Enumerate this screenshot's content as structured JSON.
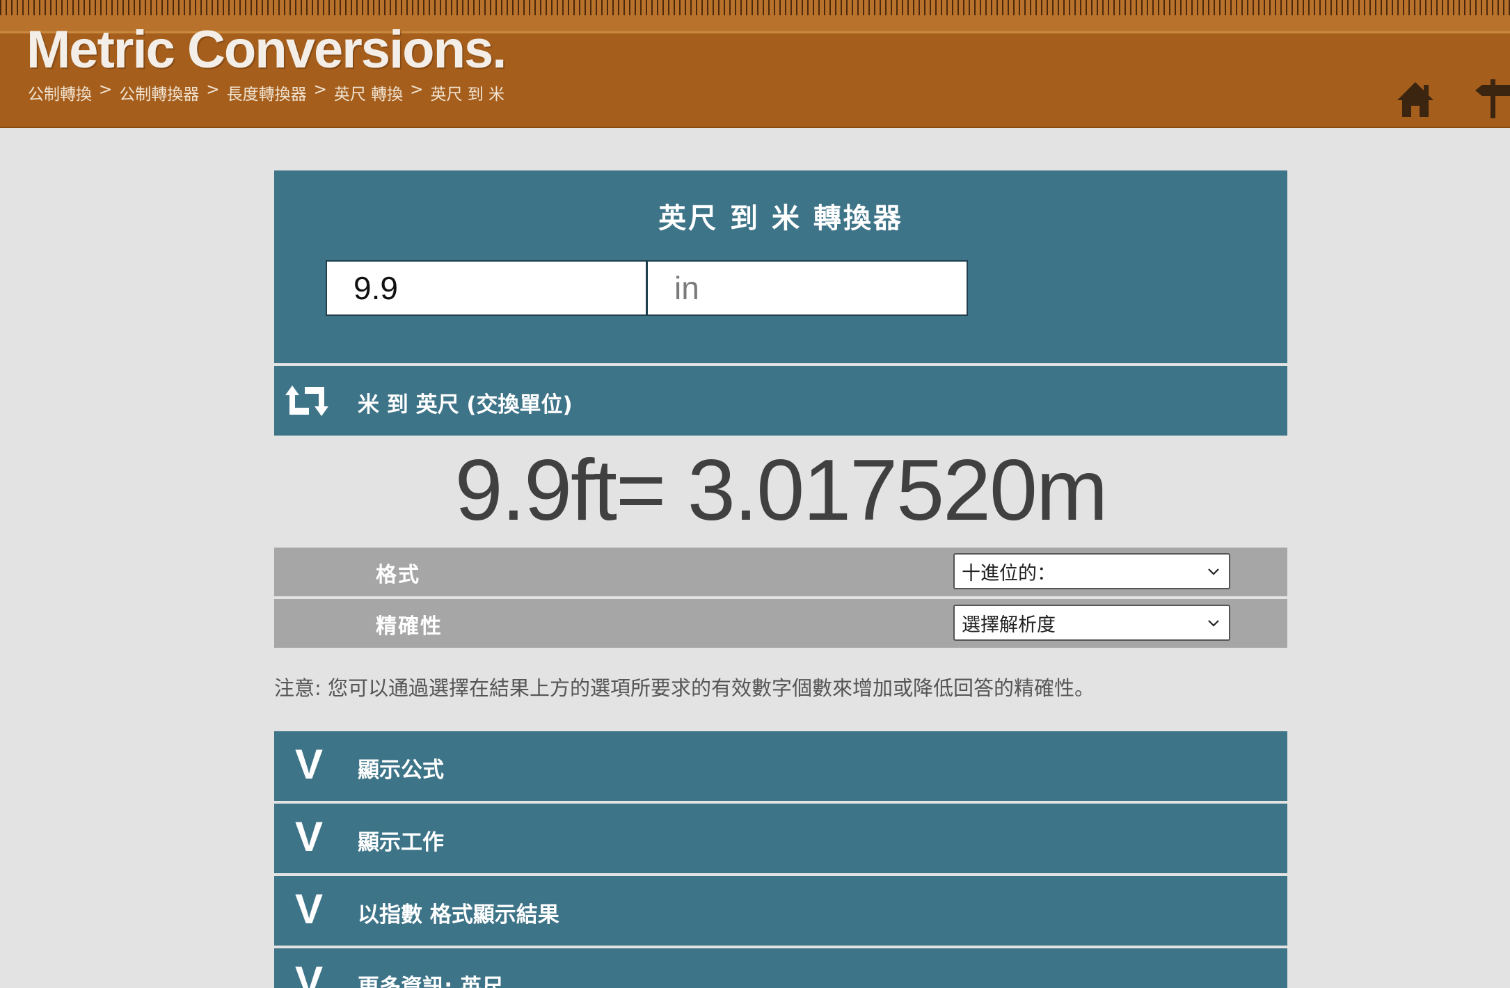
{
  "header": {
    "logo": "Metric Conversions.",
    "breadcrumb": [
      "公制轉換",
      "公制轉換器",
      "長度轉換器",
      "英尺 轉換",
      "英尺 到 米"
    ],
    "sep": ">"
  },
  "converter": {
    "title": "英尺 到 米 轉換器",
    "value": "9.9",
    "unit": "in"
  },
  "swap": {
    "label": "米 到 英尺 (交換單位)"
  },
  "result": {
    "text": "9.9ft= 3.017520m"
  },
  "options": {
    "format_label": "格式",
    "format_value": "十進位的：",
    "precision_label": "精確性",
    "precision_value": "選擇解析度"
  },
  "note": "注意: 您可以通過選擇在結果上方的選項所要求的有效數字個數來增加或降低回答的精確性。",
  "accordions": [
    {
      "icon": "V",
      "label": "顯示公式"
    },
    {
      "icon": "V",
      "label": "顯示工作"
    },
    {
      "icon": "V",
      "label": "以指數 格式顯示結果"
    },
    {
      "icon": "V",
      "label": "更多資訊: 英尺"
    }
  ],
  "colors": {
    "header": "#a55e1c",
    "panel": "#3e7488",
    "option_row": "#a6a6a6",
    "background": "#e3e3e3"
  }
}
